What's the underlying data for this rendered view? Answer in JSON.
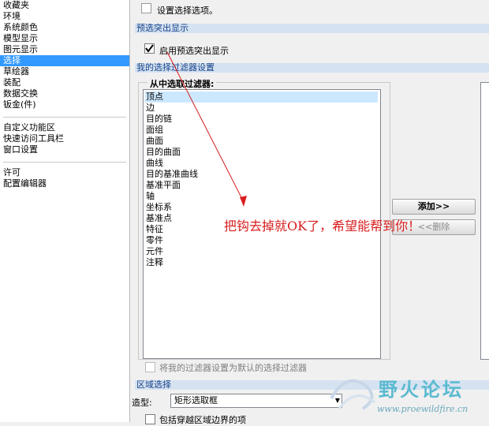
{
  "sidebar": {
    "items": [
      "收藏夹",
      "环境",
      "系统颜色",
      "模型显示",
      "图元显示",
      "选择",
      "草绘器",
      "装配",
      "数据交换",
      "钣金(件)"
    ],
    "items2": [
      "自定义功能区",
      "快速访问工具栏",
      "窗口设置"
    ],
    "items3": [
      "许可",
      "配置编辑器"
    ],
    "selected": "选择"
  },
  "main": {
    "top_option": "设置选择选项。",
    "preselect": {
      "header": "预选突出显示",
      "checkbox_label": "启用预选突出显示",
      "checked": true
    },
    "filters": {
      "header": "我的选择过滤器设置",
      "group_title": "从中选取过滤器:",
      "list": [
        "顶点",
        "边",
        "目的链",
        "面组",
        "曲面",
        "目的曲面",
        "曲线",
        "目的基准曲线",
        "基准平面",
        "轴",
        "坐标系",
        "基准点",
        "特征",
        "零件",
        "元件",
        "注释"
      ],
      "selected": "顶点",
      "add_button": "添加>>",
      "remove_button": "<<删除",
      "default_checkbox": "将我的过滤器设置为默认的选择过滤器"
    },
    "region": {
      "header": "区域选择",
      "shape_label": "造型:",
      "shape_value": "矩形选取框",
      "include_checkbox": "包括穿越区域边界的项"
    }
  },
  "annotation": {
    "text": "把钩去掉就OK了，希望能帮到你！",
    "color": "#d81e1e"
  },
  "watermark": {
    "text": "野火论坛",
    "url": "www.proewildfire.cn"
  }
}
